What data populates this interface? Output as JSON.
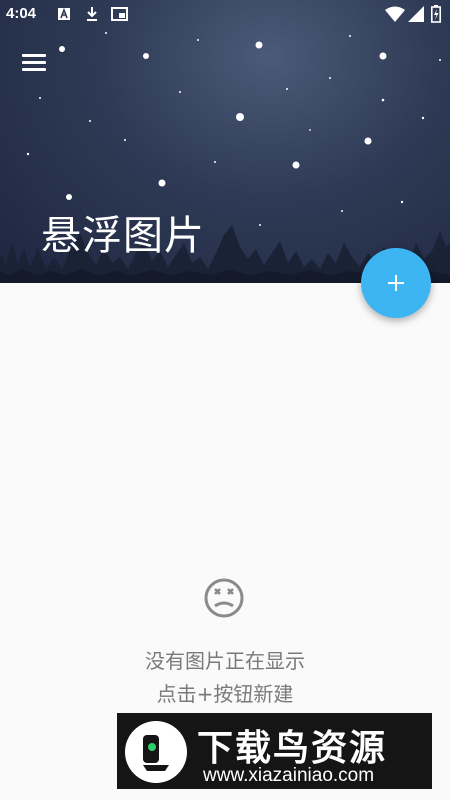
{
  "status_bar": {
    "time": "4:04",
    "left_icons": [
      "a-notification-icon",
      "download-icon",
      "picture-in-picture-icon"
    ],
    "right_icons": [
      "wifi-icon",
      "signal-icon",
      "battery-charging-icon"
    ]
  },
  "header": {
    "title": "悬浮图片",
    "menu_icon": "hamburger-menu-icon"
  },
  "fab": {
    "icon": "plus-icon",
    "color": "#3db5f3"
  },
  "empty_state": {
    "icon": "sad-face-icon",
    "line1": "没有图片正在显示",
    "line2": "点击+按钮新建"
  },
  "watermark": {
    "title": "下载鸟资源",
    "url": "www.xiazainiao.com"
  },
  "colors": {
    "header_dark": "#1e2640",
    "accent": "#3db5f3",
    "background": "#fafafa"
  }
}
